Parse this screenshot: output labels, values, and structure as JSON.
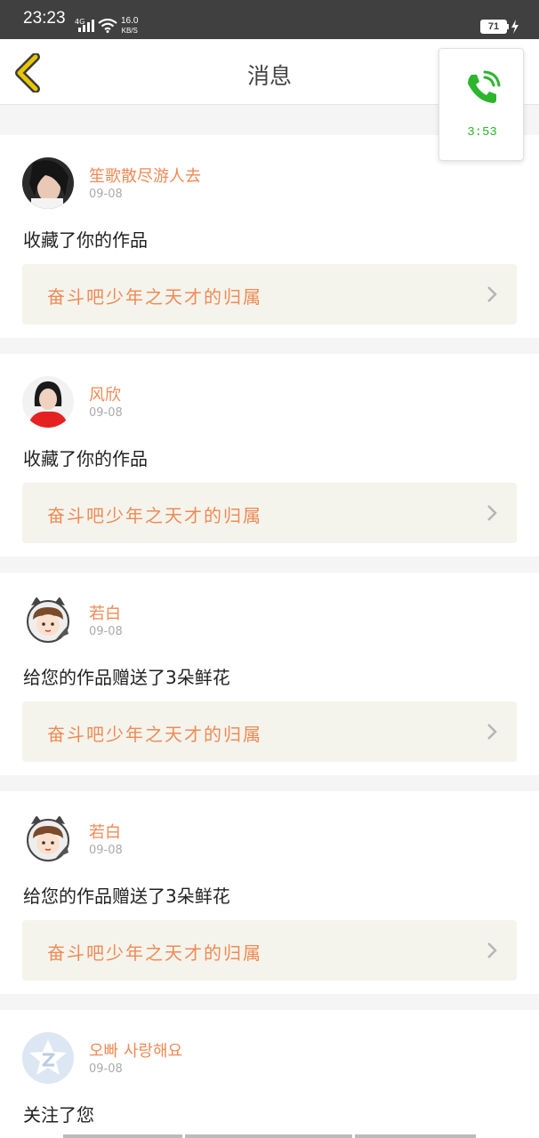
{
  "status_bar": {
    "time": "23:23",
    "network": "4G",
    "speed_value": "16.0",
    "speed_unit": "KB/S",
    "battery": "71"
  },
  "header": {
    "title": "消息",
    "back_icon": "chevron-left-icon"
  },
  "call_widget": {
    "icon": "phone-icon",
    "timer": "3:53",
    "color": "#2db52d"
  },
  "messages": [
    {
      "username": "笙歌散尽游人去",
      "date": "09-08",
      "action": "收藏了你的作品",
      "work_title": "奋斗吧少年之天才的归属"
    },
    {
      "username": "风欣",
      "date": "09-08",
      "action": "收藏了你的作品",
      "work_title": "奋斗吧少年之天才的归属"
    },
    {
      "username": "若白",
      "date": "09-08",
      "action": "给您的作品赠送了3朵鲜花",
      "work_title": "奋斗吧少年之天才的归属"
    },
    {
      "username": "若白",
      "date": "09-08",
      "action": "给您的作品赠送了3朵鲜花",
      "work_title": "奋斗吧少年之天才的归属"
    },
    {
      "username": "오빠 사랑해요",
      "date": "09-08",
      "action": "关注了您"
    }
  ],
  "colors": {
    "accent": "#f08a55",
    "link_bg": "#f4f4ec",
    "back_arrow": "#e8c600"
  }
}
